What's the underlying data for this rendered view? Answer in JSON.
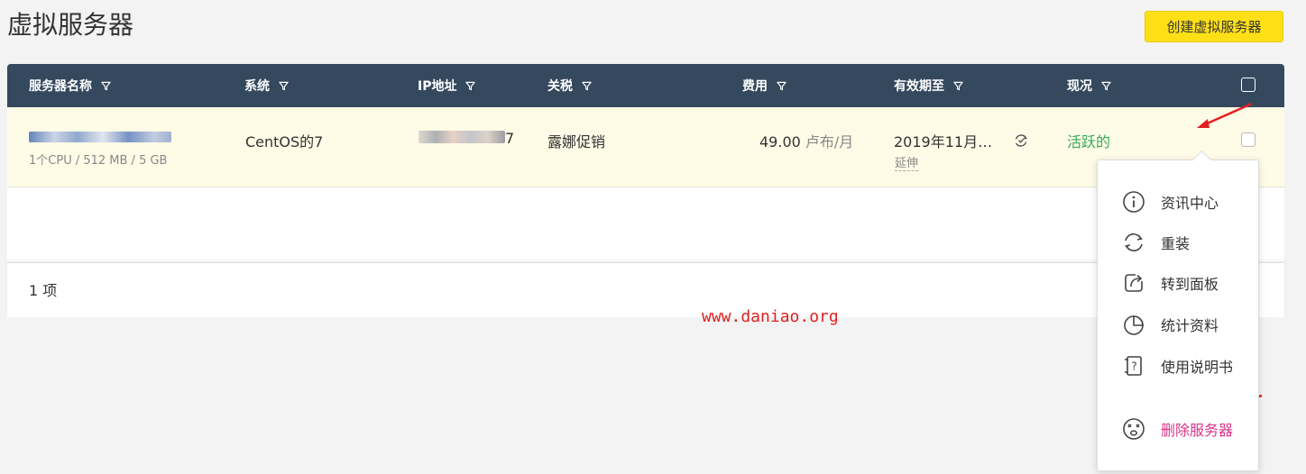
{
  "page": {
    "title": "虚拟服务器",
    "create_button": "创建虚拟服务器"
  },
  "table": {
    "headers": {
      "name": "服务器名称",
      "system": "系统",
      "ip": "IP地址",
      "tariff": "关税",
      "cost": "费用",
      "valid_until": "有效期至",
      "status": "现况"
    },
    "row": {
      "name_suffix": "",
      "spec": "1个CPU / 512 MB / 5 GB",
      "system": "CentOS的7",
      "ip_suffix": "7",
      "tariff": "露娜促销",
      "cost_value": "49.00",
      "cost_unit": "卢布/月",
      "valid_until": "2019年11月…",
      "extend_link": "延伸",
      "status": "活跃的"
    },
    "footer_count": "1 项"
  },
  "menu": {
    "items": [
      {
        "label": "资讯中心",
        "icon": "info-icon"
      },
      {
        "label": "重装",
        "icon": "reinstall-icon"
      },
      {
        "label": "转到面板",
        "icon": "goto-panel-icon"
      },
      {
        "label": "统计资料",
        "icon": "statistics-icon"
      },
      {
        "label": "使用说明书",
        "icon": "manual-icon"
      }
    ],
    "delete": {
      "label": "删除服务器",
      "icon": "delete-server-icon"
    }
  },
  "watermark": "www.daniao.org",
  "colors": {
    "header_bg": "#34495e",
    "create_button_bg": "#ffe017",
    "row_highlight": "#fefbe6",
    "status_active": "#3aaa5c",
    "delete_text": "#d9348a",
    "annotation_arrow": "#e02020"
  }
}
